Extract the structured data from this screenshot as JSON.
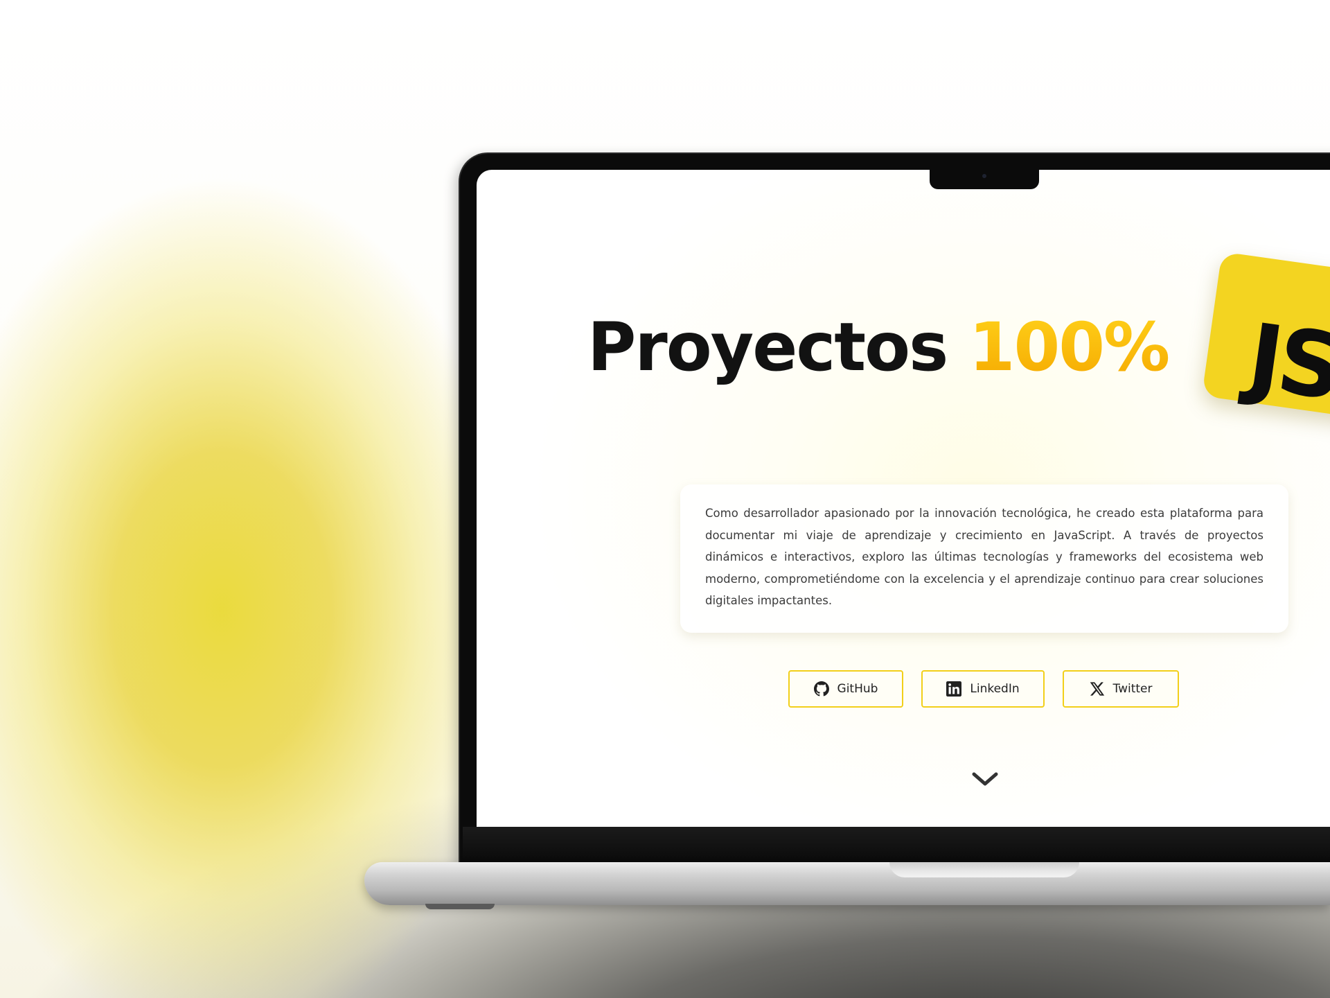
{
  "hero": {
    "title_main": "Proyectos ",
    "title_accent": "100%",
    "badge_text": "JS"
  },
  "about": {
    "text": "Como desarrollador apasionado por la innovación tecnológica, he creado esta plataforma para documentar mi viaje de aprendizaje y crecimiento en JavaScript. A través de proyectos dinámicos e interactivos, exploro las últimas tecnologías y frameworks del ecosistema web moderno, comprometiéndome con la excelencia y el aprendizaje continuo para crear soluciones digitales impactantes."
  },
  "social": {
    "github": {
      "label": "GitHub",
      "icon": "github-icon"
    },
    "linkedin": {
      "label": "LinkedIn",
      "icon": "linkedin-icon"
    },
    "twitter": {
      "label": "Twitter",
      "icon": "x-icon"
    }
  },
  "scroll": {
    "icon": "chevron-down-icon"
  },
  "colors": {
    "accent_yellow": "#f3d421",
    "accent_orange": "#f5a800",
    "button_border": "#f2cf1a",
    "text_dark": "#121212",
    "body_text": "#3b3b3b"
  }
}
